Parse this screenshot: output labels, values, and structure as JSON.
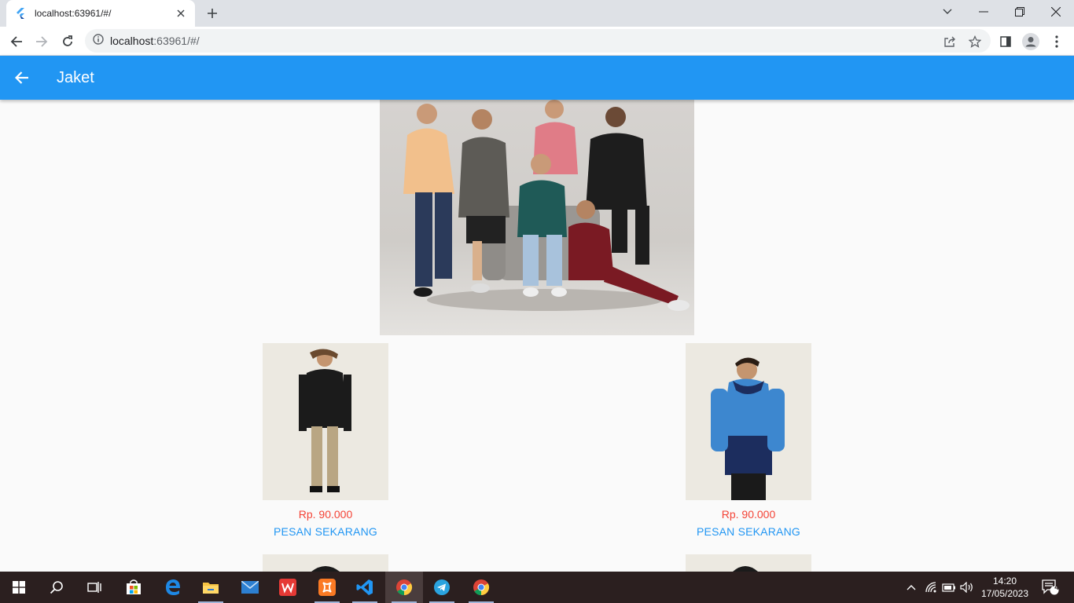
{
  "browser": {
    "tab_title": "localhost:63961/#/",
    "url_host": "localhost",
    "url_rest": ":63961/#/"
  },
  "appbar": {
    "title": "Jaket",
    "color": "#2196f3"
  },
  "products": [
    {
      "price": "Rp. 90.000",
      "action": "PESAN SEKARANG"
    },
    {
      "price": "Rp. 90.000",
      "action": "PESAN SEKARANG"
    }
  ],
  "taskbar": {
    "time": "14:20",
    "date": "17/05/2023",
    "notifications": "4",
    "apps": [
      "start-icon",
      "search-icon",
      "task-view-icon",
      "store-icon",
      "edge-icon",
      "file-explorer-icon",
      "mail-icon",
      "wps-office-icon",
      "xampp-icon",
      "vscode-icon",
      "chrome-icon",
      "telegram-icon",
      "chrome-icon"
    ]
  },
  "colors": {
    "price": "#f44336",
    "action": "#2196f3"
  }
}
